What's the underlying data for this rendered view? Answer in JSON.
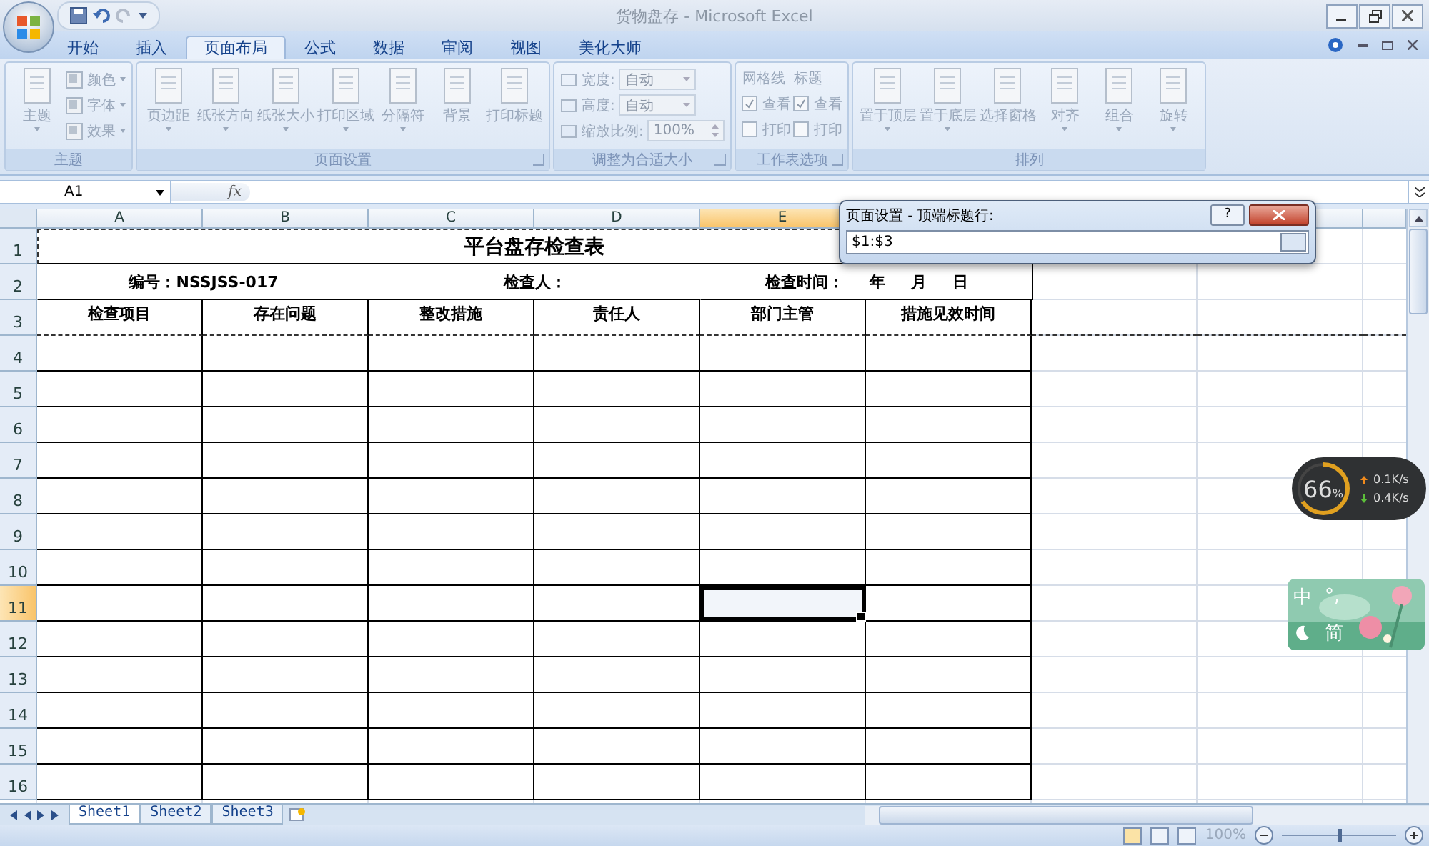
{
  "window": {
    "title": "货物盘存 - Microsoft Excel"
  },
  "tabs": [
    {
      "label": "开始",
      "selected": false
    },
    {
      "label": "插入",
      "selected": false
    },
    {
      "label": "页面布局",
      "selected": true
    },
    {
      "label": "公式",
      "selected": false
    },
    {
      "label": "数据",
      "selected": false
    },
    {
      "label": "审阅",
      "selected": false
    },
    {
      "label": "视图",
      "selected": false
    },
    {
      "label": "美化大师",
      "selected": false
    }
  ],
  "ribbon": {
    "disabled": true,
    "groups": [
      {
        "label": "主题",
        "launcher": false,
        "items": [
          {
            "kind": "big",
            "label": "主题",
            "menu": true
          },
          {
            "kind": "smalls",
            "options": [
              {
                "label": "颜色"
              },
              {
                "label": "字体"
              },
              {
                "label": "效果"
              }
            ]
          }
        ]
      },
      {
        "label": "页面设置",
        "launcher": true,
        "items": [
          {
            "kind": "big",
            "label": "页边距",
            "menu": true
          },
          {
            "kind": "big",
            "label": "纸张方向",
            "menu": true
          },
          {
            "kind": "big",
            "label": "纸张大小",
            "menu": true
          },
          {
            "kind": "big",
            "label": "打印区域",
            "menu": true
          },
          {
            "kind": "big",
            "label": "分隔符",
            "menu": true
          },
          {
            "kind": "big",
            "label": "背景",
            "menu": false
          },
          {
            "kind": "big",
            "label": "打印标题",
            "menu": false
          }
        ]
      },
      {
        "label": "调整为合适大小",
        "launcher": true,
        "items": [
          {
            "kind": "fields",
            "options": [
              {
                "label": "宽度:",
                "value": "自动",
                "kind": "dropdown"
              },
              {
                "label": "高度:",
                "value": "自动",
                "kind": "dropdown"
              },
              {
                "label": "缩放比例:",
                "value": "100%",
                "kind": "spin"
              }
            ]
          }
        ]
      },
      {
        "label": "工作表选项",
        "launcher": true,
        "items": [
          {
            "kind": "checks",
            "title": "网格线",
            "options": [
              {
                "label": "查看",
                "checked": true
              },
              {
                "label": "打印",
                "checked": false
              }
            ]
          },
          {
            "kind": "checks",
            "title": "标题",
            "options": [
              {
                "label": "查看",
                "checked": true
              },
              {
                "label": "打印",
                "checked": false
              }
            ]
          }
        ]
      },
      {
        "label": "排列",
        "launcher": false,
        "items": [
          {
            "kind": "big",
            "label": "置于顶层",
            "menu": true
          },
          {
            "kind": "big",
            "label": "置于底层",
            "menu": true
          },
          {
            "kind": "big",
            "label": "选择窗格",
            "menu": false
          },
          {
            "kind": "big",
            "label": "对齐",
            "menu": true
          },
          {
            "kind": "big",
            "label": "组合",
            "menu": true
          },
          {
            "kind": "big",
            "label": "旋转",
            "menu": true
          }
        ]
      }
    ]
  },
  "formula_bar": {
    "name_box": "A1",
    "function_button": "fx"
  },
  "sheet": {
    "columns": [
      "A",
      "B",
      "C",
      "D",
      "E"
    ],
    "title_row": {
      "number": "1",
      "title": "平台盘存检查表"
    },
    "info_row": {
      "number": "2",
      "items": [
        {
          "label": "编号：NSSJSS-017"
        },
        {
          "label": "检查人："
        },
        {
          "label": "检查时间：",
          "parts": [
            "年",
            "月",
            "日"
          ]
        }
      ]
    },
    "header_row": {
      "number": "3",
      "headers": [
        "检查项目",
        "存在问题",
        "整改措施",
        "责任人",
        "部门主管",
        "措施见效时间"
      ]
    },
    "rows": [
      {
        "number": "4",
        "cells": [
          {
            "selected": false
          },
          {
            "selected": false
          },
          {
            "selected": false
          },
          {
            "selected": false
          },
          {
            "selected": false
          },
          {
            "selected": false
          }
        ]
      },
      {
        "number": "5",
        "cells": [
          {
            "selected": false
          },
          {
            "selected": false
          },
          {
            "selected": false
          },
          {
            "selected": false
          },
          {
            "selected": false
          },
          {
            "selected": false
          }
        ]
      },
      {
        "number": "6",
        "cells": [
          {
            "selected": false
          },
          {
            "selected": false
          },
          {
            "selected": false
          },
          {
            "selected": false
          },
          {
            "selected": false
          },
          {
            "selected": false
          }
        ]
      },
      {
        "number": "7",
        "cells": [
          {
            "selected": false
          },
          {
            "selected": false
          },
          {
            "selected": false
          },
          {
            "selected": false
          },
          {
            "selected": false
          },
          {
            "selected": false
          }
        ]
      },
      {
        "number": "8",
        "cells": [
          {
            "selected": false
          },
          {
            "selected": false
          },
          {
            "selected": false
          },
          {
            "selected": false
          },
          {
            "selected": false
          },
          {
            "selected": false
          }
        ]
      },
      {
        "number": "9",
        "cells": [
          {
            "selected": false
          },
          {
            "selected": false
          },
          {
            "selected": false
          },
          {
            "selected": false
          },
          {
            "selected": false
          },
          {
            "selected": false
          }
        ]
      },
      {
        "number": "10",
        "cells": [
          {
            "selected": false
          },
          {
            "selected": false
          },
          {
            "selected": false
          },
          {
            "selected": false
          },
          {
            "selected": false
          },
          {
            "selected": false
          }
        ]
      },
      {
        "number": "11",
        "cells": [
          {
            "selected": false
          },
          {
            "selected": false
          },
          {
            "selected": false
          },
          {
            "selected": false
          },
          {
            "selected": true
          },
          {
            "selected": false
          }
        ]
      },
      {
        "number": "12",
        "cells": [
          {
            "selected": false
          },
          {
            "selected": false
          },
          {
            "selected": false
          },
          {
            "selected": false
          },
          {
            "selected": false
          },
          {
            "selected": false
          }
        ]
      },
      {
        "number": "13",
        "cells": [
          {
            "selected": false
          },
          {
            "selected": false
          },
          {
            "selected": false
          },
          {
            "selected": false
          },
          {
            "selected": false
          },
          {
            "selected": false
          }
        ]
      },
      {
        "number": "14",
        "cells": [
          {
            "selected": false
          },
          {
            "selected": false
          },
          {
            "selected": false
          },
          {
            "selected": false
          },
          {
            "selected": false
          },
          {
            "selected": false
          }
        ]
      },
      {
        "number": "15",
        "cells": [
          {
            "selected": false
          },
          {
            "selected": false
          },
          {
            "selected": false
          },
          {
            "selected": false
          },
          {
            "selected": false
          },
          {
            "selected": false
          }
        ]
      },
      {
        "number": "16",
        "cells": [
          {
            "selected": false
          },
          {
            "selected": false
          },
          {
            "selected": false
          },
          {
            "selected": false
          },
          {
            "selected": false
          },
          {
            "selected": false
          }
        ]
      }
    ]
  },
  "dialog": {
    "title": "页面设置 - 顶端标题行:",
    "help": "?",
    "value": "$1:$3"
  },
  "sheet_tabs": [
    {
      "label": "Sheet1",
      "selected": true
    },
    {
      "label": "Sheet2",
      "selected": false
    },
    {
      "label": "Sheet3",
      "selected": false
    }
  ],
  "status_bar": {
    "zoom": "100%",
    "zoom_slider": {
      "level": 0.5
    }
  },
  "net_meter": {
    "percent": "66",
    "unit": "%",
    "level": 0.66,
    "upload": "0.1K/s",
    "download": "0.4K/s"
  },
  "ime": {
    "mode": "中",
    "punctuation": "°,",
    "script": "简"
  }
}
